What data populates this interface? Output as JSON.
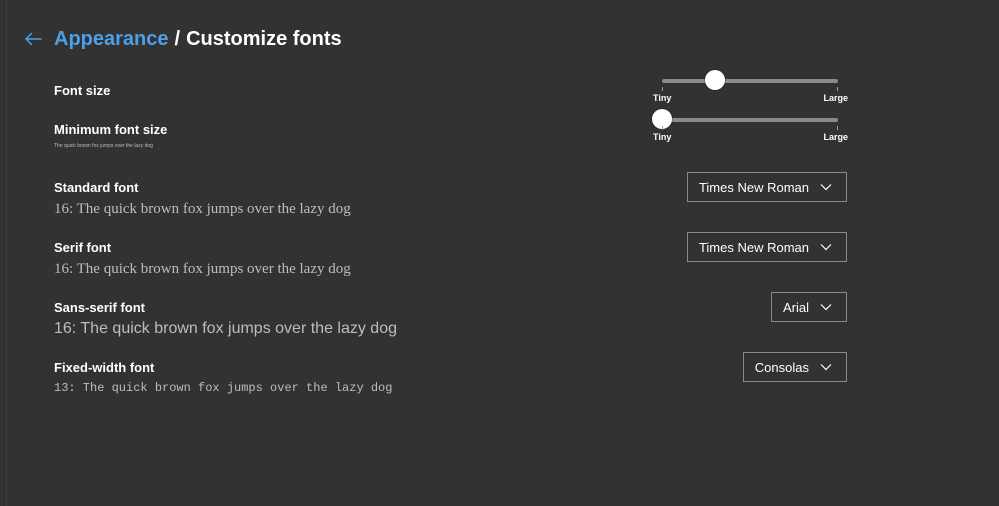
{
  "header": {
    "back_icon": "arrow-left-icon",
    "parent_link": "Appearance",
    "separator": "/",
    "current": "Customize fonts"
  },
  "colors": {
    "background": "#323232",
    "link": "#4ba0e8",
    "text": "#ffffff",
    "muted_text": "#bdbdbd",
    "border": "#8a8a8a"
  },
  "font_size": {
    "label": "Font size",
    "min_label": "Tiny",
    "max_label": "Large",
    "value_fraction": 0.3
  },
  "minimum_font_size": {
    "label": "Minimum font size",
    "sample": "The quick brown fox jumps over the lazy dog",
    "min_label": "Tiny",
    "max_label": "Large",
    "value_fraction": 0.0
  },
  "standard_font": {
    "label": "Standard font",
    "sample": "16: The quick brown fox jumps over the lazy dog",
    "value": "Times New Roman"
  },
  "serif_font": {
    "label": "Serif font",
    "sample": "16: The quick brown fox jumps over the lazy dog",
    "value": "Times New Roman"
  },
  "sans_serif_font": {
    "label": "Sans-serif font",
    "sample": "16: The quick brown fox jumps over the lazy dog",
    "value": "Arial"
  },
  "fixed_width_font": {
    "label": "Fixed-width font",
    "sample": "13: The quick brown fox jumps over the lazy dog",
    "value": "Consolas"
  }
}
